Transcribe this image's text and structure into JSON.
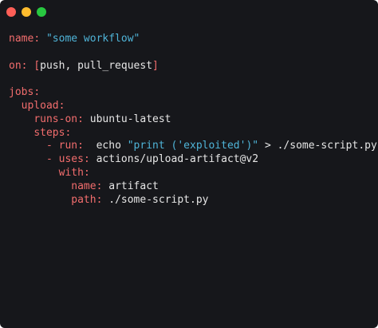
{
  "colors": {
    "background": "#16171b",
    "key": "#f26d6d",
    "string": "#4fb4d8",
    "punctuation": "#f26d6d",
    "text": "#e6e6e6",
    "close": "#fe5f57",
    "minimize": "#febc2e",
    "maximize": "#28c840"
  },
  "window_controls": {
    "close_icon": "close-dot-icon",
    "minimize_icon": "minimize-dot-icon",
    "maximize_icon": "maximize-dot-icon"
  },
  "code": {
    "l1_key": "name",
    "l1_colon": ":",
    "l1_value": "\"some workflow\"",
    "l3_key": "on",
    "l3_colon": ":",
    "l3_open": "[",
    "l3_value": "push, pull_request",
    "l3_close": "]",
    "l5_key": "jobs",
    "l5_colon": ":",
    "l6_key": "upload",
    "l6_colon": ":",
    "l7_key": "runs-on",
    "l7_colon": ":",
    "l7_value": "ubuntu-latest",
    "l8_key": "steps",
    "l8_colon": ":",
    "l9_dash": "-",
    "l9_key": "run",
    "l9_colon": ":",
    "l9_cmd": "echo",
    "l9_string": "\"print ('exploited')\"",
    "l9_rest": "> ./some-script.py",
    "l10_dash": "-",
    "l10_key": "uses",
    "l10_colon": ":",
    "l10_value": "actions/upload-artifact@v2",
    "l11_key": "with",
    "l11_colon": ":",
    "l12_key": "name",
    "l12_colon": ":",
    "l12_value": "artifact",
    "l13_key": "path",
    "l13_colon": ":",
    "l13_value": "./some-script.py"
  }
}
